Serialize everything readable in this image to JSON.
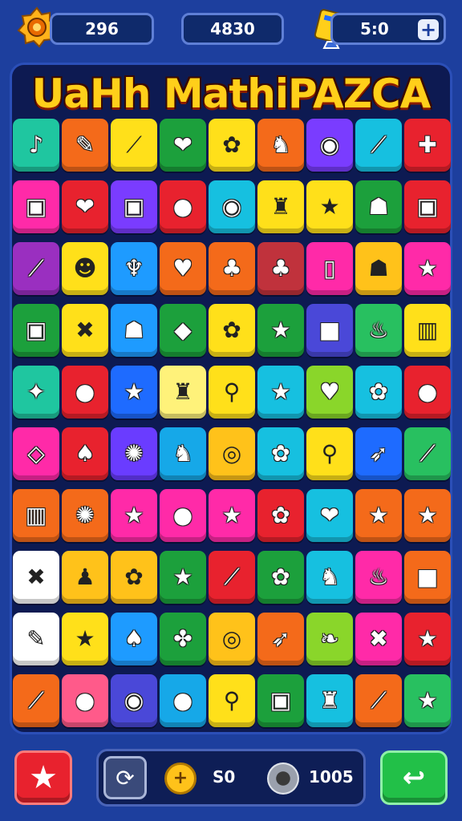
{
  "hud": {
    "level_value": "296",
    "score_value": "4830",
    "tickets_value": "5:0",
    "plus_label": "+"
  },
  "title": "UaHh MathiPAZCA",
  "board": {
    "rows": [
      [
        {
          "color": "#1fc6a0",
          "glyph": "♪"
        },
        {
          "color": "#f46a1a",
          "glyph": "✎"
        },
        {
          "color": "#ffe01a",
          "glyph": "⟋",
          "dark": true
        },
        {
          "color": "#1ca03c",
          "glyph": "❤"
        },
        {
          "color": "#ffe01a",
          "glyph": "✿",
          "dark": true
        },
        {
          "color": "#f46a1a",
          "glyph": "♞"
        },
        {
          "color": "#7a3cff",
          "glyph": "◉"
        },
        {
          "color": "#16c0e0",
          "glyph": "⟋"
        },
        {
          "color": "#e8222e",
          "glyph": "✚"
        }
      ],
      [
        {
          "color": "#ff2aa8",
          "glyph": "▣"
        },
        {
          "color": "#e8222e",
          "glyph": "❤"
        },
        {
          "color": "#7a3cff",
          "glyph": "▣"
        },
        {
          "color": "#e8222e",
          "glyph": "●"
        },
        {
          "color": "#16c0e0",
          "glyph": "◉"
        },
        {
          "color": "#ffe01a",
          "glyph": "♜",
          "dark": true
        },
        {
          "color": "#ffe01a",
          "glyph": "★",
          "dark": true
        },
        {
          "color": "#1ca03c",
          "glyph": "☗"
        },
        {
          "color": "#e8222e",
          "glyph": "▣"
        }
      ],
      [
        {
          "color": "#9a2fc0",
          "glyph": "⟋"
        },
        {
          "color": "#ffe01a",
          "glyph": "☻",
          "dark": true
        },
        {
          "color": "#1e9bff",
          "glyph": "♆"
        },
        {
          "color": "#f46a1a",
          "glyph": "♥"
        },
        {
          "color": "#f46a1a",
          "glyph": "♣"
        },
        {
          "color": "#c0323c",
          "glyph": "♣"
        },
        {
          "color": "#ff2aa8",
          "glyph": "▯"
        },
        {
          "color": "#ffc21a",
          "glyph": "☗",
          "dark": true
        },
        {
          "color": "#ff2aa8",
          "glyph": "★"
        }
      ],
      [
        {
          "color": "#1ca03c",
          "glyph": "▣"
        },
        {
          "color": "#ffe01a",
          "glyph": "✖",
          "dark": true
        },
        {
          "color": "#1e9bff",
          "glyph": "☗"
        },
        {
          "color": "#1ca03c",
          "glyph": "◆"
        },
        {
          "color": "#ffe01a",
          "glyph": "✿",
          "dark": true
        },
        {
          "color": "#1ca03c",
          "glyph": "★"
        },
        {
          "color": "#4a48d8",
          "glyph": "■"
        },
        {
          "color": "#28c060",
          "glyph": "♨"
        },
        {
          "color": "#ffe01a",
          "glyph": "▥",
          "dark": true
        }
      ],
      [
        {
          "color": "#1fc6a0",
          "glyph": "✦"
        },
        {
          "color": "#e8222e",
          "glyph": "●"
        },
        {
          "color": "#1e6bff",
          "glyph": "★"
        },
        {
          "color": "#fff27a",
          "glyph": "♜",
          "dark": true
        },
        {
          "color": "#ffe01a",
          "glyph": "⚲",
          "dark": true
        },
        {
          "color": "#16c0e0",
          "glyph": "★"
        },
        {
          "color": "#8ad62a",
          "glyph": "♥"
        },
        {
          "color": "#16c0e0",
          "glyph": "✿"
        },
        {
          "color": "#e8222e",
          "glyph": "●"
        }
      ],
      [
        {
          "color": "#ff2aa8",
          "glyph": "◇"
        },
        {
          "color": "#e8222e",
          "glyph": "♠"
        },
        {
          "color": "#6a3cff",
          "glyph": "✺"
        },
        {
          "color": "#16a8e8",
          "glyph": "♞"
        },
        {
          "color": "#ffc21a",
          "glyph": "◎",
          "dark": true
        },
        {
          "color": "#16c0e0",
          "glyph": "✿"
        },
        {
          "color": "#ffe01a",
          "glyph": "⚲",
          "dark": true
        },
        {
          "color": "#1e6bff",
          "glyph": "➶"
        },
        {
          "color": "#28c060",
          "glyph": "⟋"
        }
      ],
      [
        {
          "color": "#f46a1a",
          "glyph": "▥"
        },
        {
          "color": "#f46a1a",
          "glyph": "✺"
        },
        {
          "color": "#ff2aa8",
          "glyph": "★"
        },
        {
          "color": "#ff2aa8",
          "glyph": "●"
        },
        {
          "color": "#ff2aa8",
          "glyph": "★"
        },
        {
          "color": "#e8222e",
          "glyph": "✿"
        },
        {
          "color": "#16c0e0",
          "glyph": "❤"
        },
        {
          "color": "#f46a1a",
          "glyph": "★"
        },
        {
          "color": "#f46a1a",
          "glyph": "★"
        }
      ],
      [
        {
          "color": "#ffffff",
          "glyph": "✖",
          "dark": true
        },
        {
          "color": "#ffc21a",
          "glyph": "♟",
          "dark": true
        },
        {
          "color": "#ffc21a",
          "glyph": "✿",
          "dark": true
        },
        {
          "color": "#1ca03c",
          "glyph": "★"
        },
        {
          "color": "#e8222e",
          "glyph": "⟋"
        },
        {
          "color": "#1ca03c",
          "glyph": "✿"
        },
        {
          "color": "#16c0e0",
          "glyph": "♞"
        },
        {
          "color": "#ff2aa8",
          "glyph": "♨"
        },
        {
          "color": "#f46a1a",
          "glyph": "■"
        }
      ],
      [
        {
          "color": "#ffffff",
          "glyph": "✎",
          "dark": true
        },
        {
          "color": "#ffe01a",
          "glyph": "★",
          "dark": true
        },
        {
          "color": "#1e9bff",
          "glyph": "♠"
        },
        {
          "color": "#1ca03c",
          "glyph": "✤"
        },
        {
          "color": "#ffc21a",
          "glyph": "◎",
          "dark": true
        },
        {
          "color": "#f46a1a",
          "glyph": "➶"
        },
        {
          "color": "#8ad62a",
          "glyph": "❧"
        },
        {
          "color": "#ff2aa8",
          "glyph": "✖"
        },
        {
          "color": "#e8222e",
          "glyph": "★"
        }
      ],
      [
        {
          "color": "#f46a1a",
          "glyph": "⟋"
        },
        {
          "color": "#ff5a8a",
          "glyph": "●"
        },
        {
          "color": "#4a48d8",
          "glyph": "◉"
        },
        {
          "color": "#16a8e8",
          "glyph": "●"
        },
        {
          "color": "#ffe01a",
          "glyph": "⚲",
          "dark": true
        },
        {
          "color": "#1ca03c",
          "glyph": "▣"
        },
        {
          "color": "#16c0e0",
          "glyph": "♜"
        },
        {
          "color": "#f46a1a",
          "glyph": "⟋"
        },
        {
          "color": "#28c060",
          "glyph": "★"
        }
      ]
    ]
  },
  "bottom": {
    "star_glyph": "★",
    "shuffle_glyph": "⟳",
    "coin_glyph": "+",
    "coins_value": "S0",
    "gems_value": "1005",
    "go_glyph": "↩"
  }
}
